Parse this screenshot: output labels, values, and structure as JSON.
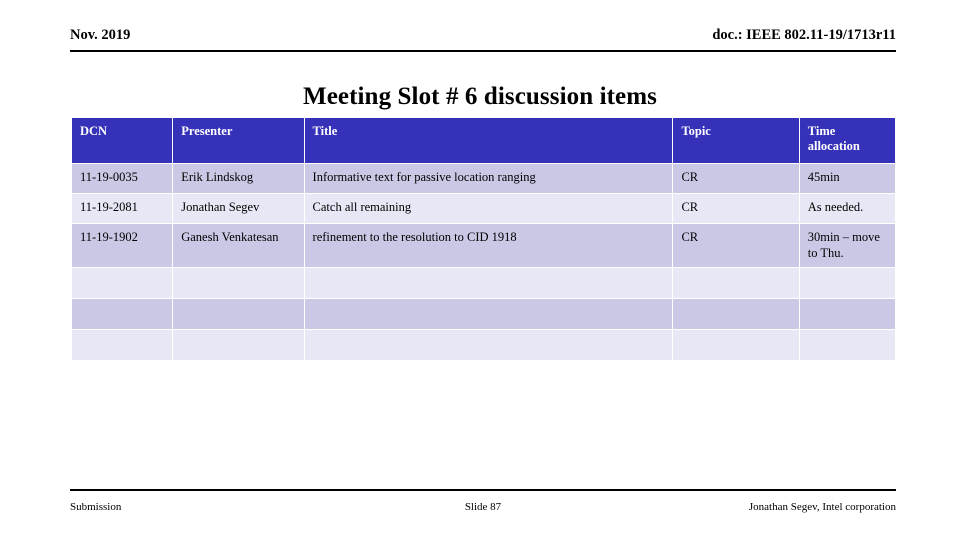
{
  "header": {
    "left": "Nov. 2019",
    "right": "doc.: IEEE 802.11-19/1713r11"
  },
  "title": "Meeting Slot # 6 discussion items",
  "table": {
    "columns": [
      "DCN",
      "Presenter",
      "Title",
      "Topic",
      "Time allocation"
    ],
    "rows": [
      {
        "dcn": "11-19-0035",
        "presenter": "Erik Lindskog",
        "title": "Informative text for passive location ranging",
        "topic": "CR",
        "time": "45min"
      },
      {
        "dcn": "11-19-2081",
        "presenter": "Jonathan Segev",
        "title": "Catch all remaining",
        "topic": "CR",
        "time": "As needed."
      },
      {
        "dcn": "11-19-1902",
        "presenter": "Ganesh Venkatesan",
        "title": "refinement to the resolution to CID 1918",
        "topic": "CR",
        "time": "30min – move to Thu."
      },
      {
        "dcn": "",
        "presenter": "",
        "title": "",
        "topic": "",
        "time": ""
      },
      {
        "dcn": "",
        "presenter": "",
        "title": "",
        "topic": "",
        "time": ""
      },
      {
        "dcn": "",
        "presenter": "",
        "title": "",
        "topic": "",
        "time": ""
      }
    ]
  },
  "footer": {
    "left": "Submission",
    "center": "Slide 87",
    "right": "Jonathan Segev, Intel corporation"
  },
  "colors": {
    "header_fill": "#3531b8",
    "row_dark": "#c9c9e6",
    "row_light": "#e7e7f6",
    "text": "#000000"
  }
}
